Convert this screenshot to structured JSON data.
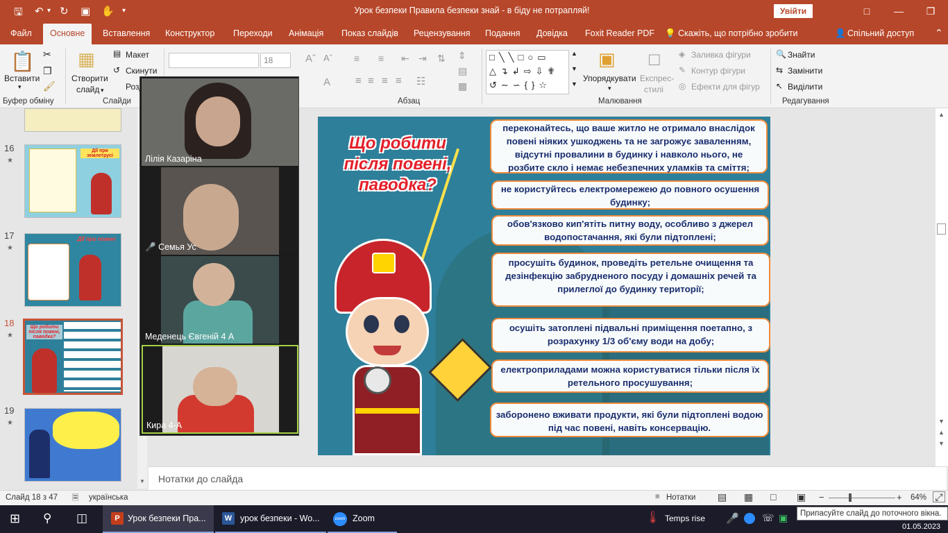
{
  "window": {
    "title": "Урок безпеки Правила безпеки знай - в біду не потрапляй!",
    "signin": "Увійти"
  },
  "menu": {
    "tabs": [
      "Файл",
      "Основне",
      "Вставлення",
      "Конструктор",
      "Переходи",
      "Анімація",
      "Показ слайдів",
      "Рецензування",
      "Подання",
      "Довідка",
      "Foxit Reader PDF"
    ],
    "tell_me": "Скажіть, що потрібно зробити",
    "share": "Спільний доступ"
  },
  "ribbon": {
    "paste": "Вставити",
    "clipboard_group": "Буфер обміну",
    "new_slide_1": "Створити",
    "new_slide_2": "слайд",
    "layout": "Макет",
    "reset": "Скинути",
    "section": "Розділ",
    "slides_group": "Слайди",
    "font_size": "18",
    "paragraph_group": "Абзац",
    "arrange": "Упорядкувати",
    "quick_styles_1": "Експрес-",
    "quick_styles_2": "стилі",
    "shape_fill": "Заливка фігури",
    "shape_outline": "Контур фігури",
    "shape_effects": "Ефекти для фігур",
    "drawing_group": "Малювання",
    "find": "Знайти",
    "replace": "Замінити",
    "select": "Виділити",
    "editing_group": "Редагування"
  },
  "slides": [
    {
      "num": "16",
      "title": "ДІЇ при землетрусі"
    },
    {
      "num": "17",
      "title": "ДІЇ при повені"
    },
    {
      "num": "18",
      "title": "Що робити після повені, паводка?"
    },
    {
      "num": "19",
      "title": ""
    }
  ],
  "zoom": {
    "participants": [
      {
        "name": "Лілія Казаріна",
        "muted": false
      },
      {
        "name": "Семья Ус",
        "muted": true
      },
      {
        "name": "Меденець Євгеній 4 А",
        "muted": false
      },
      {
        "name": "Кира 4-А",
        "muted": false
      }
    ]
  },
  "slide": {
    "heading": "Що робити після повені, паводка?",
    "bullets": [
      "переконайтесь, що ваше житло не отримало внаслідок повені ніяких ушкоджень та не загрожує заваленням, відсутні провалини в будинку і навколо нього, не розбите скло і немає небезпечних уламків та сміття;",
      "не користуйтесь електромережею до повного осушення будинку;",
      "обов'язково кип'ятіть питну воду, особливо з джерел водопостачання, які були підтоплені;",
      "просушіть будинок, проведіть ретельне очищення та дезінфекцію забрудненого посуду і домашніх речей та прилеглої до будинку території;",
      "осушіть затоплені підвальні приміщення поетапно, з розрахунку 1/3 об'єму води на добу;",
      "електроприладами можна користуватися тільки після їх ретельного просушування;",
      "заборонено вживати продукти, які були підтоплені водою під час повені, навіть консервацію."
    ]
  },
  "notes": {
    "placeholder": "Нотатки до слайда"
  },
  "status": {
    "slide": "Слайд 18 з 47",
    "language": "українська",
    "notes": "Нотатки",
    "zoom": "64%",
    "zoom_level": 0.64
  },
  "taskbar": {
    "apps": [
      "Урок безпеки Пра...",
      "урок безпеки - Wo...",
      "Zoom"
    ],
    "weather": "Temps rise",
    "date": "01.05.2023"
  },
  "tooltip": "Припасуйте слайд до поточного вікна.",
  "colors": {
    "accent": "#b7472a",
    "slide_bg": "#2e7f9a",
    "bubble_border": "#ee8a3c",
    "heading": "#e4202a"
  }
}
